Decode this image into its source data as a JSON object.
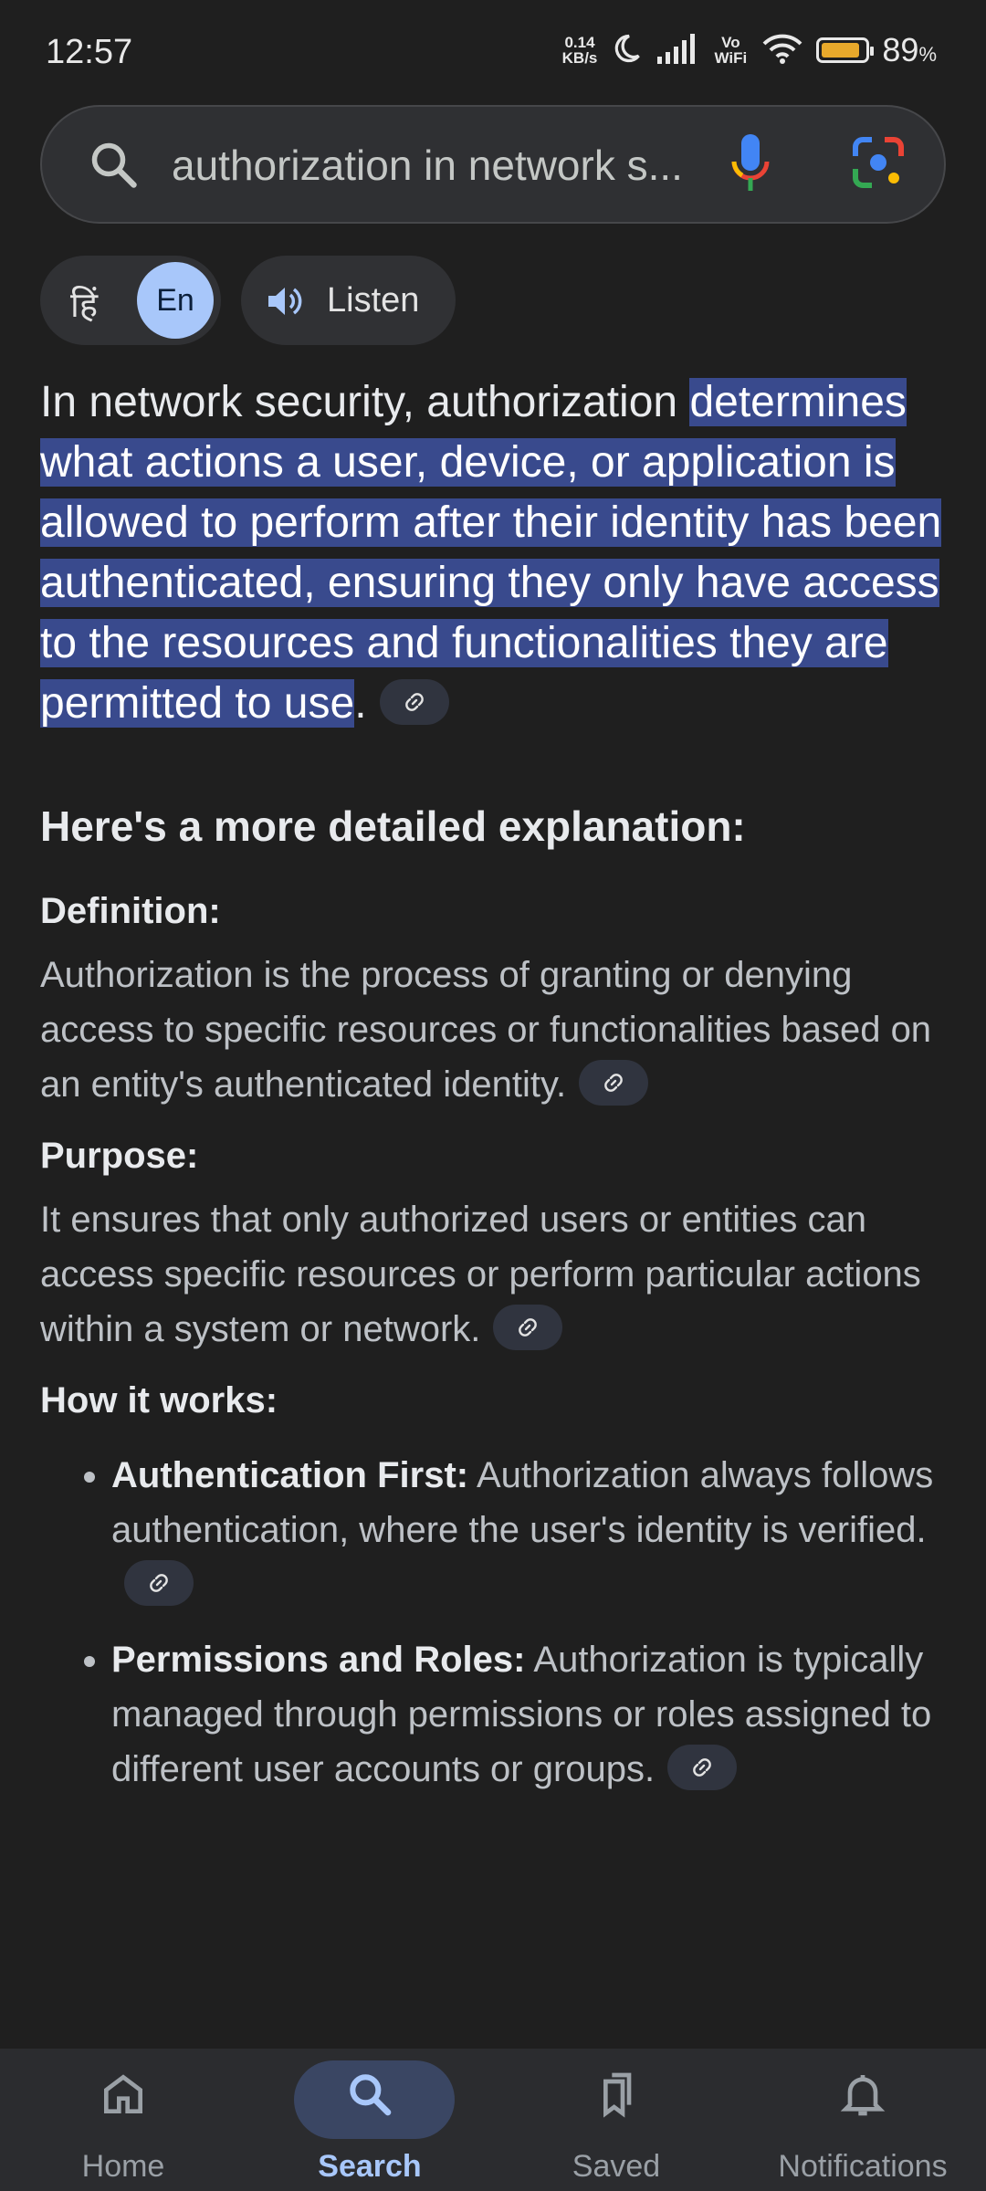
{
  "status": {
    "time": "12:57",
    "net_speed_value": "0.14",
    "net_speed_unit": "KB/s",
    "vowifi": "Vo WiFi",
    "battery_percent": "89",
    "battery_symbol": "%",
    "battery_level": 0.89
  },
  "search": {
    "query": "authorization in network s..."
  },
  "language": {
    "hindi": "हिं",
    "english": "En"
  },
  "listen_label": "Listen",
  "answer": {
    "lead_plain": "In network security, authorization ",
    "lead_highlight": "determines what actions a user, device, or application is allowed to perform after their identity has been authenticated, ensuring they only have access to the resources and functionalities they are permitted to use",
    "lead_end": ".",
    "heading": "Here's a more detailed explanation:",
    "definition_label": "Definition:",
    "definition_text": "Authorization is the process of granting or denying access to specific resources or functionalities based on an entity's authenticated identity.",
    "purpose_label": "Purpose:",
    "purpose_text": "It ensures that only authorized users or entities can access specific resources or perform particular actions within a system or network.",
    "how_label": "How it works:",
    "bullets": [
      {
        "title": "Authentication First:",
        "text": "Authorization always follows authentication, where the user's identity is verified."
      },
      {
        "title": "Permissions and Roles:",
        "text": "Authorization is typically managed through permissions or roles assigned to different user accounts or groups."
      }
    ]
  },
  "nav": {
    "items": [
      {
        "label": "Home",
        "icon": "home-icon"
      },
      {
        "label": "Search",
        "icon": "search-icon",
        "active": true
      },
      {
        "label": "Saved",
        "icon": "bookmarks-icon"
      },
      {
        "label": "Notifications",
        "icon": "bell-icon"
      }
    ]
  },
  "colors": {
    "background": "#1f1f1f",
    "highlight": "#394a8d",
    "accent": "#a8c7fa",
    "battery": "#e8a92b"
  }
}
